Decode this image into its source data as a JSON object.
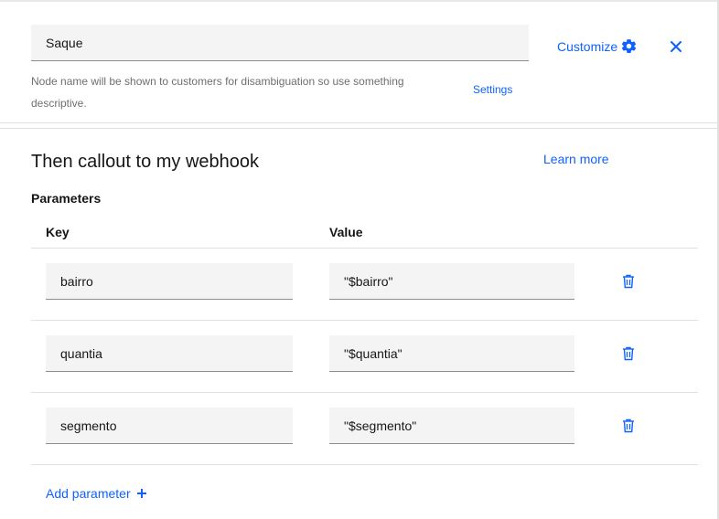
{
  "node": {
    "name_value": "Saque",
    "helper_text": "Node name will be shown to customers for disambiguation so use something descriptive.",
    "settings_label": "Settings",
    "customize_label": "Customize"
  },
  "callout": {
    "title": "Then callout to my webhook",
    "learn_more_label": "Learn more",
    "parameters_heading": "Parameters",
    "columns": {
      "key": "Key",
      "value": "Value"
    },
    "rows": [
      {
        "key": "bairro",
        "value": "\"$bairro\""
      },
      {
        "key": "quantia",
        "value": "\"$quantia\""
      },
      {
        "key": "segmento",
        "value": "\"$segmento\""
      }
    ],
    "add_parameter_label": "Add parameter"
  },
  "icons": {
    "customize": "gear-icon",
    "close": "close-icon",
    "delete": "trash-icon",
    "add": "plus-icon"
  },
  "colors": {
    "link": "#0f62fe",
    "field_bg": "#f4f4f4",
    "helper_text": "#6f6f6f"
  }
}
